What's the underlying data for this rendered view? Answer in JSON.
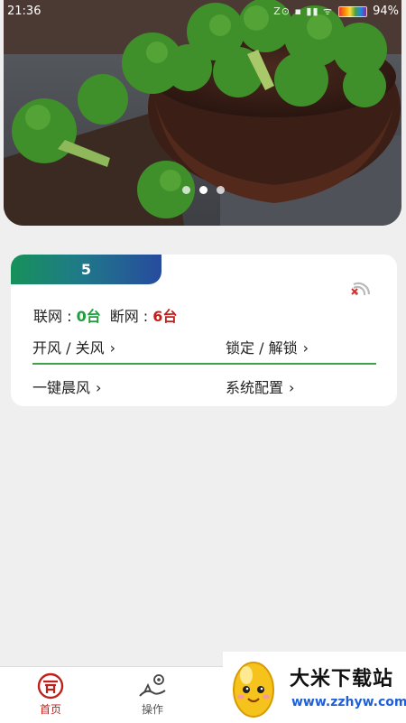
{
  "status_bar": {
    "time": "21:36",
    "icons": "Z⊙ ▪ ▮▮ ᯤ",
    "battery": "94%"
  },
  "banner": {
    "image": "broccoli-in-bowl",
    "page_count": 3,
    "active_index": 1
  },
  "device_card": {
    "tab_label": "5",
    "online_label": "联网 : ",
    "online_count": "0台",
    "offline_label": "断网 : ",
    "offline_count": "6台",
    "actions": {
      "fan_toggle": "开风 / 关风",
      "lock_toggle": "锁定 / 解锁",
      "one_key_morning": "一键晨风",
      "system_config": "系统配置"
    },
    "chevron": "›"
  },
  "bottom_nav": {
    "items": [
      {
        "label": "首页",
        "icon": "home-icon",
        "active": true
      },
      {
        "label": "操作",
        "icon": "operation-icon",
        "active": false
      }
    ]
  },
  "watermark": {
    "title": "大米下载站",
    "url": "www.zzhyw.com"
  },
  "colors": {
    "online": "#1f9d3e",
    "offline": "#c0201c",
    "accent": "#c0201c",
    "divider": "#3fa34a"
  }
}
